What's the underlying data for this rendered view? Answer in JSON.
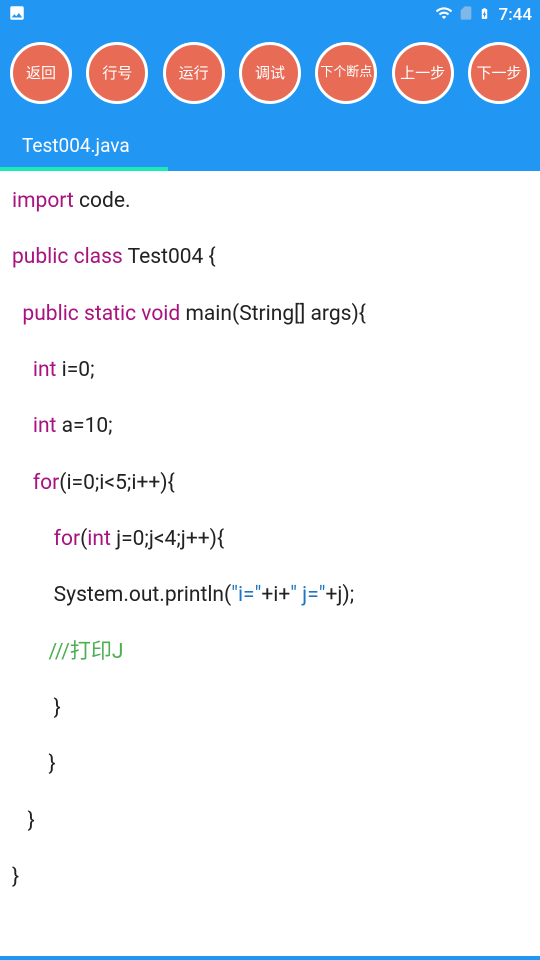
{
  "statusBar": {
    "time": "7:44"
  },
  "toolbar": {
    "buttons": [
      {
        "label": "返回",
        "name": "back-button"
      },
      {
        "label": "行号",
        "name": "line-number-button"
      },
      {
        "label": "运行",
        "name": "run-button"
      },
      {
        "label": "调试",
        "name": "debug-button"
      },
      {
        "label": "下个断点",
        "name": "next-breakpoint-button",
        "small": true
      },
      {
        "label": "上一步",
        "name": "step-back-button"
      },
      {
        "label": "下一步",
        "name": "step-forward-button"
      }
    ]
  },
  "tabs": {
    "active": "Test004.java"
  },
  "code": {
    "lines": [
      [
        {
          "t": "kw",
          "v": "import"
        },
        {
          "t": "txt",
          "v": " code."
        }
      ],
      [
        {
          "t": "txt",
          "v": ""
        }
      ],
      [
        {
          "t": "kw",
          "v": "public class"
        },
        {
          "t": "txt",
          "v": " Test004 {"
        }
      ],
      [
        {
          "t": "txt",
          "v": "  "
        },
        {
          "t": "kw",
          "v": "public static void"
        },
        {
          "t": "txt",
          "v": " main(String[] args){"
        }
      ],
      [
        {
          "t": "txt",
          "v": "    "
        },
        {
          "t": "kw",
          "v": "int"
        },
        {
          "t": "txt",
          "v": " i=0;"
        }
      ],
      [
        {
          "t": "txt",
          "v": "    "
        },
        {
          "t": "kw",
          "v": "int"
        },
        {
          "t": "txt",
          "v": " a=10;"
        }
      ],
      [
        {
          "t": "txt",
          "v": "    "
        },
        {
          "t": "kw",
          "v": "for"
        },
        {
          "t": "txt",
          "v": "(i=0;i<5;i++){"
        }
      ],
      [
        {
          "t": "txt",
          "v": "        "
        },
        {
          "t": "kw",
          "v": "for"
        },
        {
          "t": "txt",
          "v": "("
        },
        {
          "t": "kw",
          "v": "int"
        },
        {
          "t": "txt",
          "v": " j=0;j<4;j++){"
        }
      ],
      [
        {
          "t": "txt",
          "v": "        System.out.println("
        },
        {
          "t": "str",
          "v": "\"i=\""
        },
        {
          "t": "txt",
          "v": "+i+"
        },
        {
          "t": "str",
          "v": "\" j=\""
        },
        {
          "t": "txt",
          "v": "+j);"
        }
      ],
      [
        {
          "t": "txt",
          "v": "       "
        },
        {
          "t": "cmt",
          "v": "///打印J"
        }
      ],
      [
        {
          "t": "txt",
          "v": "        }"
        }
      ],
      [
        {
          "t": "txt",
          "v": "       }"
        }
      ],
      [
        {
          "t": "txt",
          "v": "   }"
        }
      ],
      [
        {
          "t": "txt",
          "v": "}"
        }
      ]
    ]
  }
}
